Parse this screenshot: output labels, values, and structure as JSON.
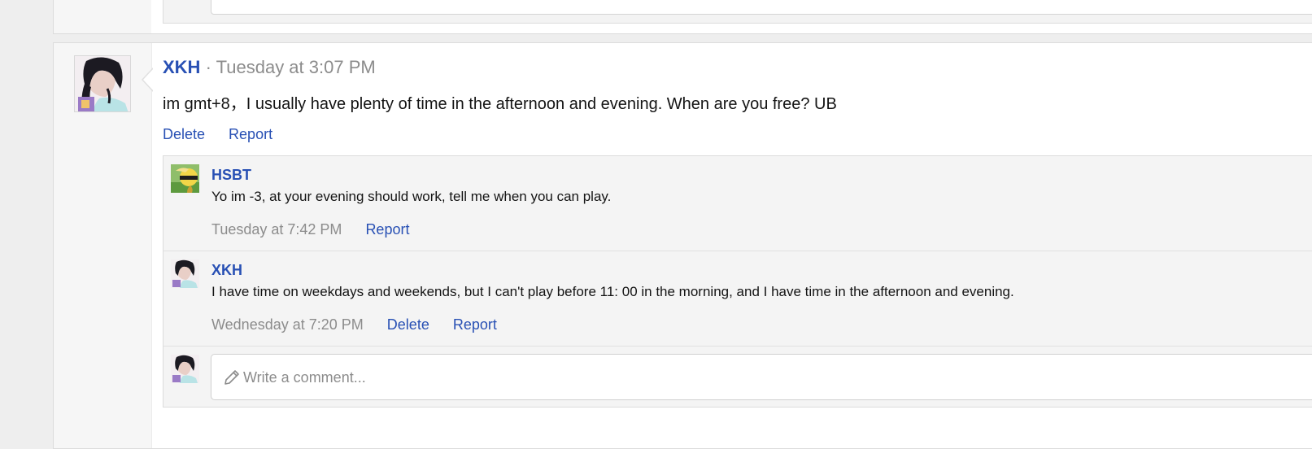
{
  "post": {
    "author": "XKH",
    "separator": "·",
    "timestamp": "Tuesday at 3:07 PM",
    "body": "im gmt+8，I usually have plenty of time in the afternoon and evening. When are you free? UB",
    "actions": {
      "delete": "Delete",
      "report": "Report"
    }
  },
  "comments": [
    {
      "author": "HSBT",
      "text": "Yo im -3, at your evening should work, tell me when you can play.",
      "timestamp": "Tuesday at 7:42 PM",
      "report": "Report"
    },
    {
      "author": "XKH",
      "text": "I have time on weekdays and weekends, but I can't play before 11: 00 in the morning, and I have time in the afternoon and evening.",
      "timestamp": "Wednesday at 7:20 PM",
      "delete": "Delete",
      "report": "Report"
    }
  ],
  "write_comment": {
    "placeholder": "Write a comment...",
    "icon": "pencil-icon"
  },
  "colors": {
    "link": "#2850b4",
    "muted": "#8c8c8c",
    "text": "#141414",
    "panel": "#f4f4f4"
  }
}
